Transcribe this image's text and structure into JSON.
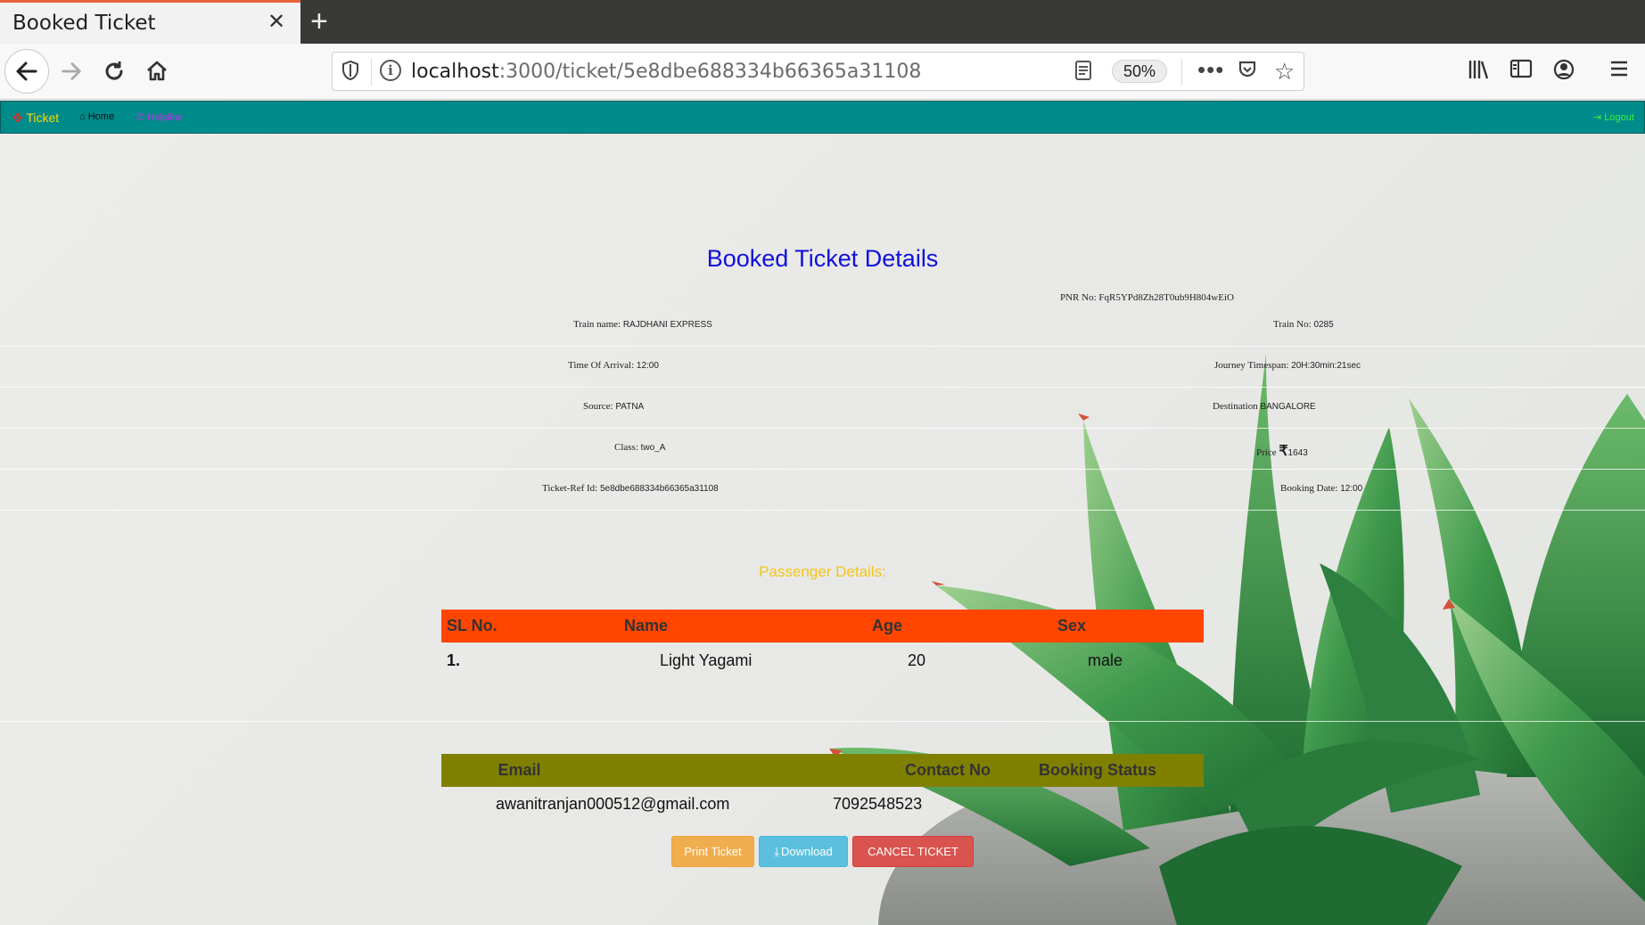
{
  "browser": {
    "tab_title": "Booked Ticket",
    "tab_close": "✕",
    "new_tab": "+",
    "url_host": "localhost",
    "url_path": ":3000/ticket/5e8dbe688334b66365a31108",
    "zoom": "50%"
  },
  "site_nav": {
    "brand": "Ticket",
    "home": "Home",
    "helpline": "Helpline",
    "logout": "Logout"
  },
  "page": {
    "title": "Booked Ticket Details",
    "pnr": "PNR No: FqR5YPd8Zh28T0ub9H804wEiO",
    "train_name_label": "Train name:",
    "train_name": "RAJDHANI EXPRESS",
    "train_no_label": "Train No:",
    "train_no": "0285",
    "arrival_label": "Time Of Arrival:",
    "arrival": "12:00",
    "timespan_label": "Journey Timespan:",
    "timespan": "20H:30min:21sec",
    "source_label": "Source:",
    "source": "PATNA",
    "destination_label": "Destination",
    "destination": "BANGALORE",
    "class_label": "Class:",
    "class": "two_A",
    "price_label": "Price",
    "currency": "₹",
    "price": "1643",
    "ticket_ref_label": "Ticket-Ref Id:",
    "ticket_ref": "5e8dbe688334b66365a31108",
    "booking_date_label": "Booking Date:",
    "booking_date": "12:00",
    "passenger_title": "Passenger Details:"
  },
  "passenger_table": {
    "headers": [
      "SL No.",
      "Name",
      "Age",
      "Sex"
    ],
    "rows": [
      [
        "1.",
        "Light Yagami",
        "20",
        "male"
      ]
    ]
  },
  "contact_table": {
    "headers": [
      "Email",
      "Contact No",
      "Booking Status"
    ],
    "rows": [
      [
        "awanitranjan000512@gmail.com",
        "7092548523",
        ""
      ]
    ]
  },
  "buttons": {
    "print": "Print Ticket",
    "download": "Download",
    "cancel": "CANCEL TICKET"
  },
  "colors": {
    "nav_bg": "#008b8b",
    "title": "#1010dd",
    "passenger_header": "#ff4500",
    "contact_header": "#808000",
    "passenger_title": "#f5c518"
  }
}
